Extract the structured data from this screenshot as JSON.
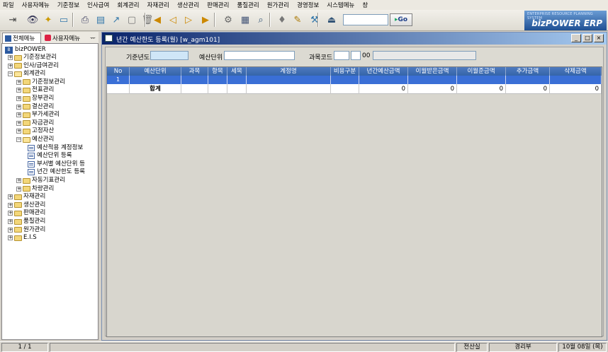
{
  "menu": [
    "파일",
    "사용자메뉴",
    "기준정보",
    "인사급여",
    "회계관리",
    "자재관리",
    "생산관리",
    "판매관리",
    "품질관리",
    "원가관리",
    "경영정보",
    "시스템메뉴",
    "창"
  ],
  "toolbar": {
    "go_label": "Go",
    "search_value": "",
    "icons": [
      "exit-icon",
      "view-icon",
      "new-icon",
      "save-icon",
      "print-icon",
      "preview-icon",
      "export-icon",
      "delete-icon",
      "trash-icon",
      "first-icon",
      "prev-icon",
      "next-icon",
      "last-icon",
      "settings-icon",
      "calc-icon",
      "find-icon",
      "help-icon",
      "info-icon",
      "tools-icon",
      "close-window-icon"
    ]
  },
  "logo": {
    "line1": "ENTERPRISE RESOURCE PLANNING SYSTEM",
    "line2": "bizPOWER ERP"
  },
  "left_tabs": {
    "all_menu": "전체메뉴",
    "user_menu": "사용자메뉴",
    "pin": "ᅲ"
  },
  "tree": {
    "root": "bizPOWER",
    "items": [
      {
        "label": "기준정보관리",
        "level": 1,
        "type": "folder"
      },
      {
        "label": "인사/급여관리",
        "level": 1,
        "type": "folder"
      },
      {
        "label": "회계관리",
        "level": 1,
        "type": "folder-open"
      },
      {
        "label": "기준정보관리",
        "level": 2,
        "type": "folder"
      },
      {
        "label": "전표관리",
        "level": 2,
        "type": "folder"
      },
      {
        "label": "장부관리",
        "level": 2,
        "type": "folder"
      },
      {
        "label": "결산관리",
        "level": 2,
        "type": "folder"
      },
      {
        "label": "부가세관리",
        "level": 2,
        "type": "folder"
      },
      {
        "label": "자금관리",
        "level": 2,
        "type": "folder"
      },
      {
        "label": "고정자산",
        "level": 2,
        "type": "folder"
      },
      {
        "label": "예산관리",
        "level": 2,
        "type": "folder-open"
      },
      {
        "label": "예산적용 계정정보",
        "level": 3,
        "type": "doc"
      },
      {
        "label": "예산단위 등록",
        "level": 3,
        "type": "doc"
      },
      {
        "label": "부서별 예산단위 등",
        "level": 3,
        "type": "doc"
      },
      {
        "label": "년간 예산한도 등록",
        "level": 3,
        "type": "doc"
      },
      {
        "label": "자동기표관리",
        "level": 2,
        "type": "folder"
      },
      {
        "label": "차량관리",
        "level": 2,
        "type": "folder"
      },
      {
        "label": "자재관리",
        "level": 1,
        "type": "folder"
      },
      {
        "label": "생산관리",
        "level": 1,
        "type": "folder"
      },
      {
        "label": "판매관리",
        "level": 1,
        "type": "folder"
      },
      {
        "label": "품질관리",
        "level": 1,
        "type": "folder"
      },
      {
        "label": "원가관리",
        "level": 1,
        "type": "folder"
      },
      {
        "label": "E.I.S",
        "level": 1,
        "type": "folder"
      }
    ]
  },
  "window": {
    "title": "년간 예산한도 등록(월) [w_agm101]",
    "min": "_",
    "max": "□",
    "close": "×"
  },
  "form": {
    "base_year_label": "기준년도",
    "base_year_value": "",
    "budget_unit_label": "예산단위",
    "budget_unit_value": "",
    "account_code_label": "과목코드",
    "account_code_suffix": "00"
  },
  "grid": {
    "columns": [
      "No",
      "예산단위",
      "과목",
      "항목",
      "세목",
      "계정명",
      "비용구분",
      "년간예산금액",
      "이월받은금액",
      "이월준금액",
      "추가금액",
      "삭제금액"
    ],
    "row1_no": "1",
    "sum_label": "합계",
    "sum_values": [
      "0",
      "0",
      "0",
      "0",
      "0"
    ]
  },
  "status": {
    "page": "1 / 1",
    "dept": "전산실",
    "user": "경리부",
    "date": "10월 08일  (목)"
  }
}
